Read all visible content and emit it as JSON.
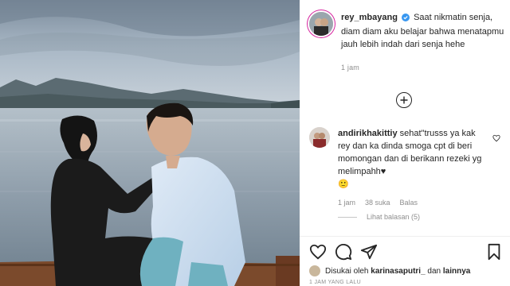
{
  "post": {
    "username": "rey_mbayang",
    "caption": "Saat nikmatin senja, diam diam aku belajar bahwa menatapmu jauh lebih indah dari senja hehe",
    "time": "1 jam"
  },
  "comment": {
    "username": "andirikhakittiy",
    "text": "sehat\"trusss ya kak rey dan ka dinda smoga cpt di beri momongan dan di berikann rezeki yg melimpahh♥",
    "emoji": "🙂",
    "time": "1 jam",
    "likes": "38 suka",
    "reply": "Balas",
    "view_replies": "Lihat balasan (5)"
  },
  "likes_line": {
    "prefix": "Disukai oleh",
    "user": "karinasaputri_",
    "middle": "dan",
    "suffix": "lainnya"
  },
  "footer_time": "1 JAM YANG LALU",
  "icons": {
    "verified": "verified-badge-icon",
    "add": "plus-circle-icon",
    "like": "heart-icon",
    "comment": "comment-bubble-icon",
    "share": "paper-plane-icon",
    "save": "bookmark-icon"
  },
  "colors": {
    "verified": "#3897f0",
    "muted": "#8e8e8e",
    "text": "#262626"
  }
}
